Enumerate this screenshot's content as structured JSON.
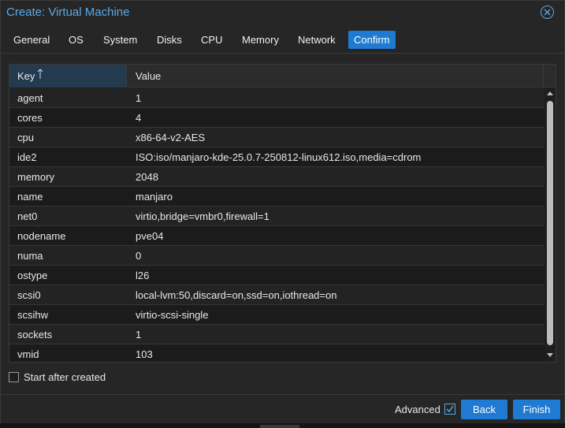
{
  "window": {
    "title": "Create: Virtual Machine"
  },
  "tabs": [
    {
      "label": "General"
    },
    {
      "label": "OS"
    },
    {
      "label": "System"
    },
    {
      "label": "Disks"
    },
    {
      "label": "CPU"
    },
    {
      "label": "Memory"
    },
    {
      "label": "Network"
    },
    {
      "label": "Confirm",
      "active": true
    }
  ],
  "grid": {
    "columns": {
      "key": "Key",
      "value": "Value"
    },
    "sort": {
      "column": "Key",
      "direction": "ascending"
    },
    "rows": [
      {
        "key": "agent",
        "value": "1"
      },
      {
        "key": "cores",
        "value": "4"
      },
      {
        "key": "cpu",
        "value": "x86-64-v2-AES"
      },
      {
        "key": "ide2",
        "value": "ISO:iso/manjaro-kde-25.0.7-250812-linux612.iso,media=cdrom"
      },
      {
        "key": "memory",
        "value": "2048"
      },
      {
        "key": "name",
        "value": "manjaro"
      },
      {
        "key": "net0",
        "value": "virtio,bridge=vmbr0,firewall=1"
      },
      {
        "key": "nodename",
        "value": "pve04"
      },
      {
        "key": "numa",
        "value": "0"
      },
      {
        "key": "ostype",
        "value": "l26"
      },
      {
        "key": "scsi0",
        "value": "local-lvm:50,discard=on,ssd=on,iothread=on"
      },
      {
        "key": "scsihw",
        "value": "virtio-scsi-single"
      },
      {
        "key": "sockets",
        "value": "1"
      },
      {
        "key": "vmid",
        "value": "103"
      }
    ]
  },
  "start_after_created": {
    "label": "Start after created",
    "checked": false
  },
  "footer": {
    "advanced_label": "Advanced",
    "advanced_checked": true,
    "back_label": "Back",
    "finish_label": "Finish"
  },
  "colors": {
    "accent": "#1f7ad2",
    "title": "#5aa9e6",
    "background": "#262626"
  },
  "icons": {
    "close": "close-circle-icon",
    "sort": "sort-ascending-arrow-icon",
    "checkbox": "checkmark-icon"
  }
}
